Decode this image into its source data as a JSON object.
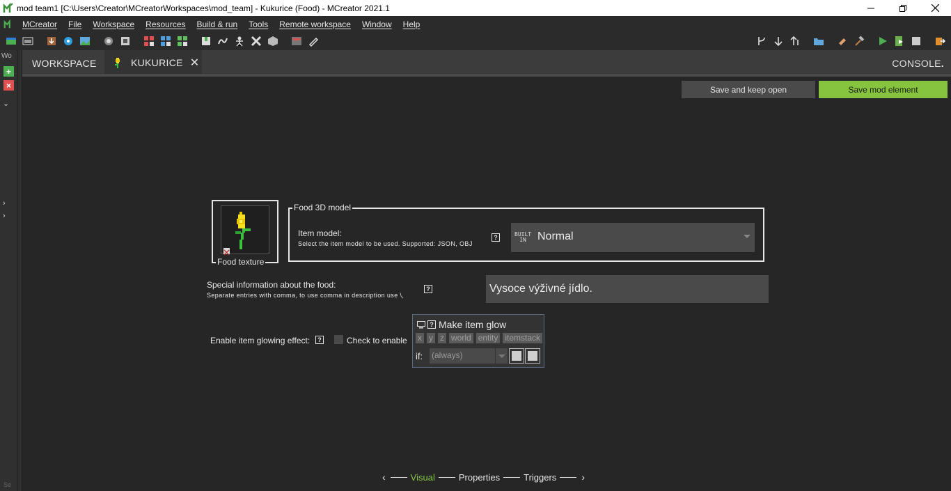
{
  "window": {
    "title": "mod team1 [C:\\Users\\Creator\\MCreatorWorkspaces\\mod_team] - Kukurice (Food) - MCreator 2021.1"
  },
  "menu": {
    "items": [
      "MCreator",
      "File",
      "Workspace",
      "Resources",
      "Build & run",
      "Tools",
      "Remote workspace",
      "Window",
      "Help"
    ]
  },
  "left_strip": {
    "label": "Wo",
    "bottom_label": "Se"
  },
  "tabs": {
    "workspace": "WORKSPACE",
    "active": "KUKURICE",
    "console": "CONSOLE"
  },
  "buttons": {
    "save_keep_open": "Save and keep open",
    "save_mod_element": "Save mod element"
  },
  "texture": {
    "label": "Food texture"
  },
  "model_group": {
    "title": "Food 3D model",
    "item_model_label": "Item model:",
    "item_model_hint": "Select the item model to be used. Supported: JSON, OBJ",
    "built_in_line1": "BUILT",
    "built_in_line2": "IN",
    "item_model_value": "Normal"
  },
  "special_info": {
    "label": "Special information about the food:",
    "hint": "Separate entries with comma, to use comma in description use \\,",
    "value": "Vysoce výživné jídlo."
  },
  "glow": {
    "label": "Enable item glowing effect:",
    "checkbox_label": "Check to enable",
    "checked": false
  },
  "procedure": {
    "title": "Make item glow",
    "dependencies": [
      "x",
      "y",
      "z",
      "world",
      "entity",
      "itemstack"
    ],
    "if_label": "if:",
    "condition_value": "(always)"
  },
  "page_nav": {
    "pages": [
      "Visual",
      "Properties",
      "Triggers"
    ],
    "active": "Visual"
  },
  "help_mark": "?",
  "colors": {
    "accent_green": "#86c440",
    "background": "#262626",
    "panel": "#4a4a4a"
  }
}
